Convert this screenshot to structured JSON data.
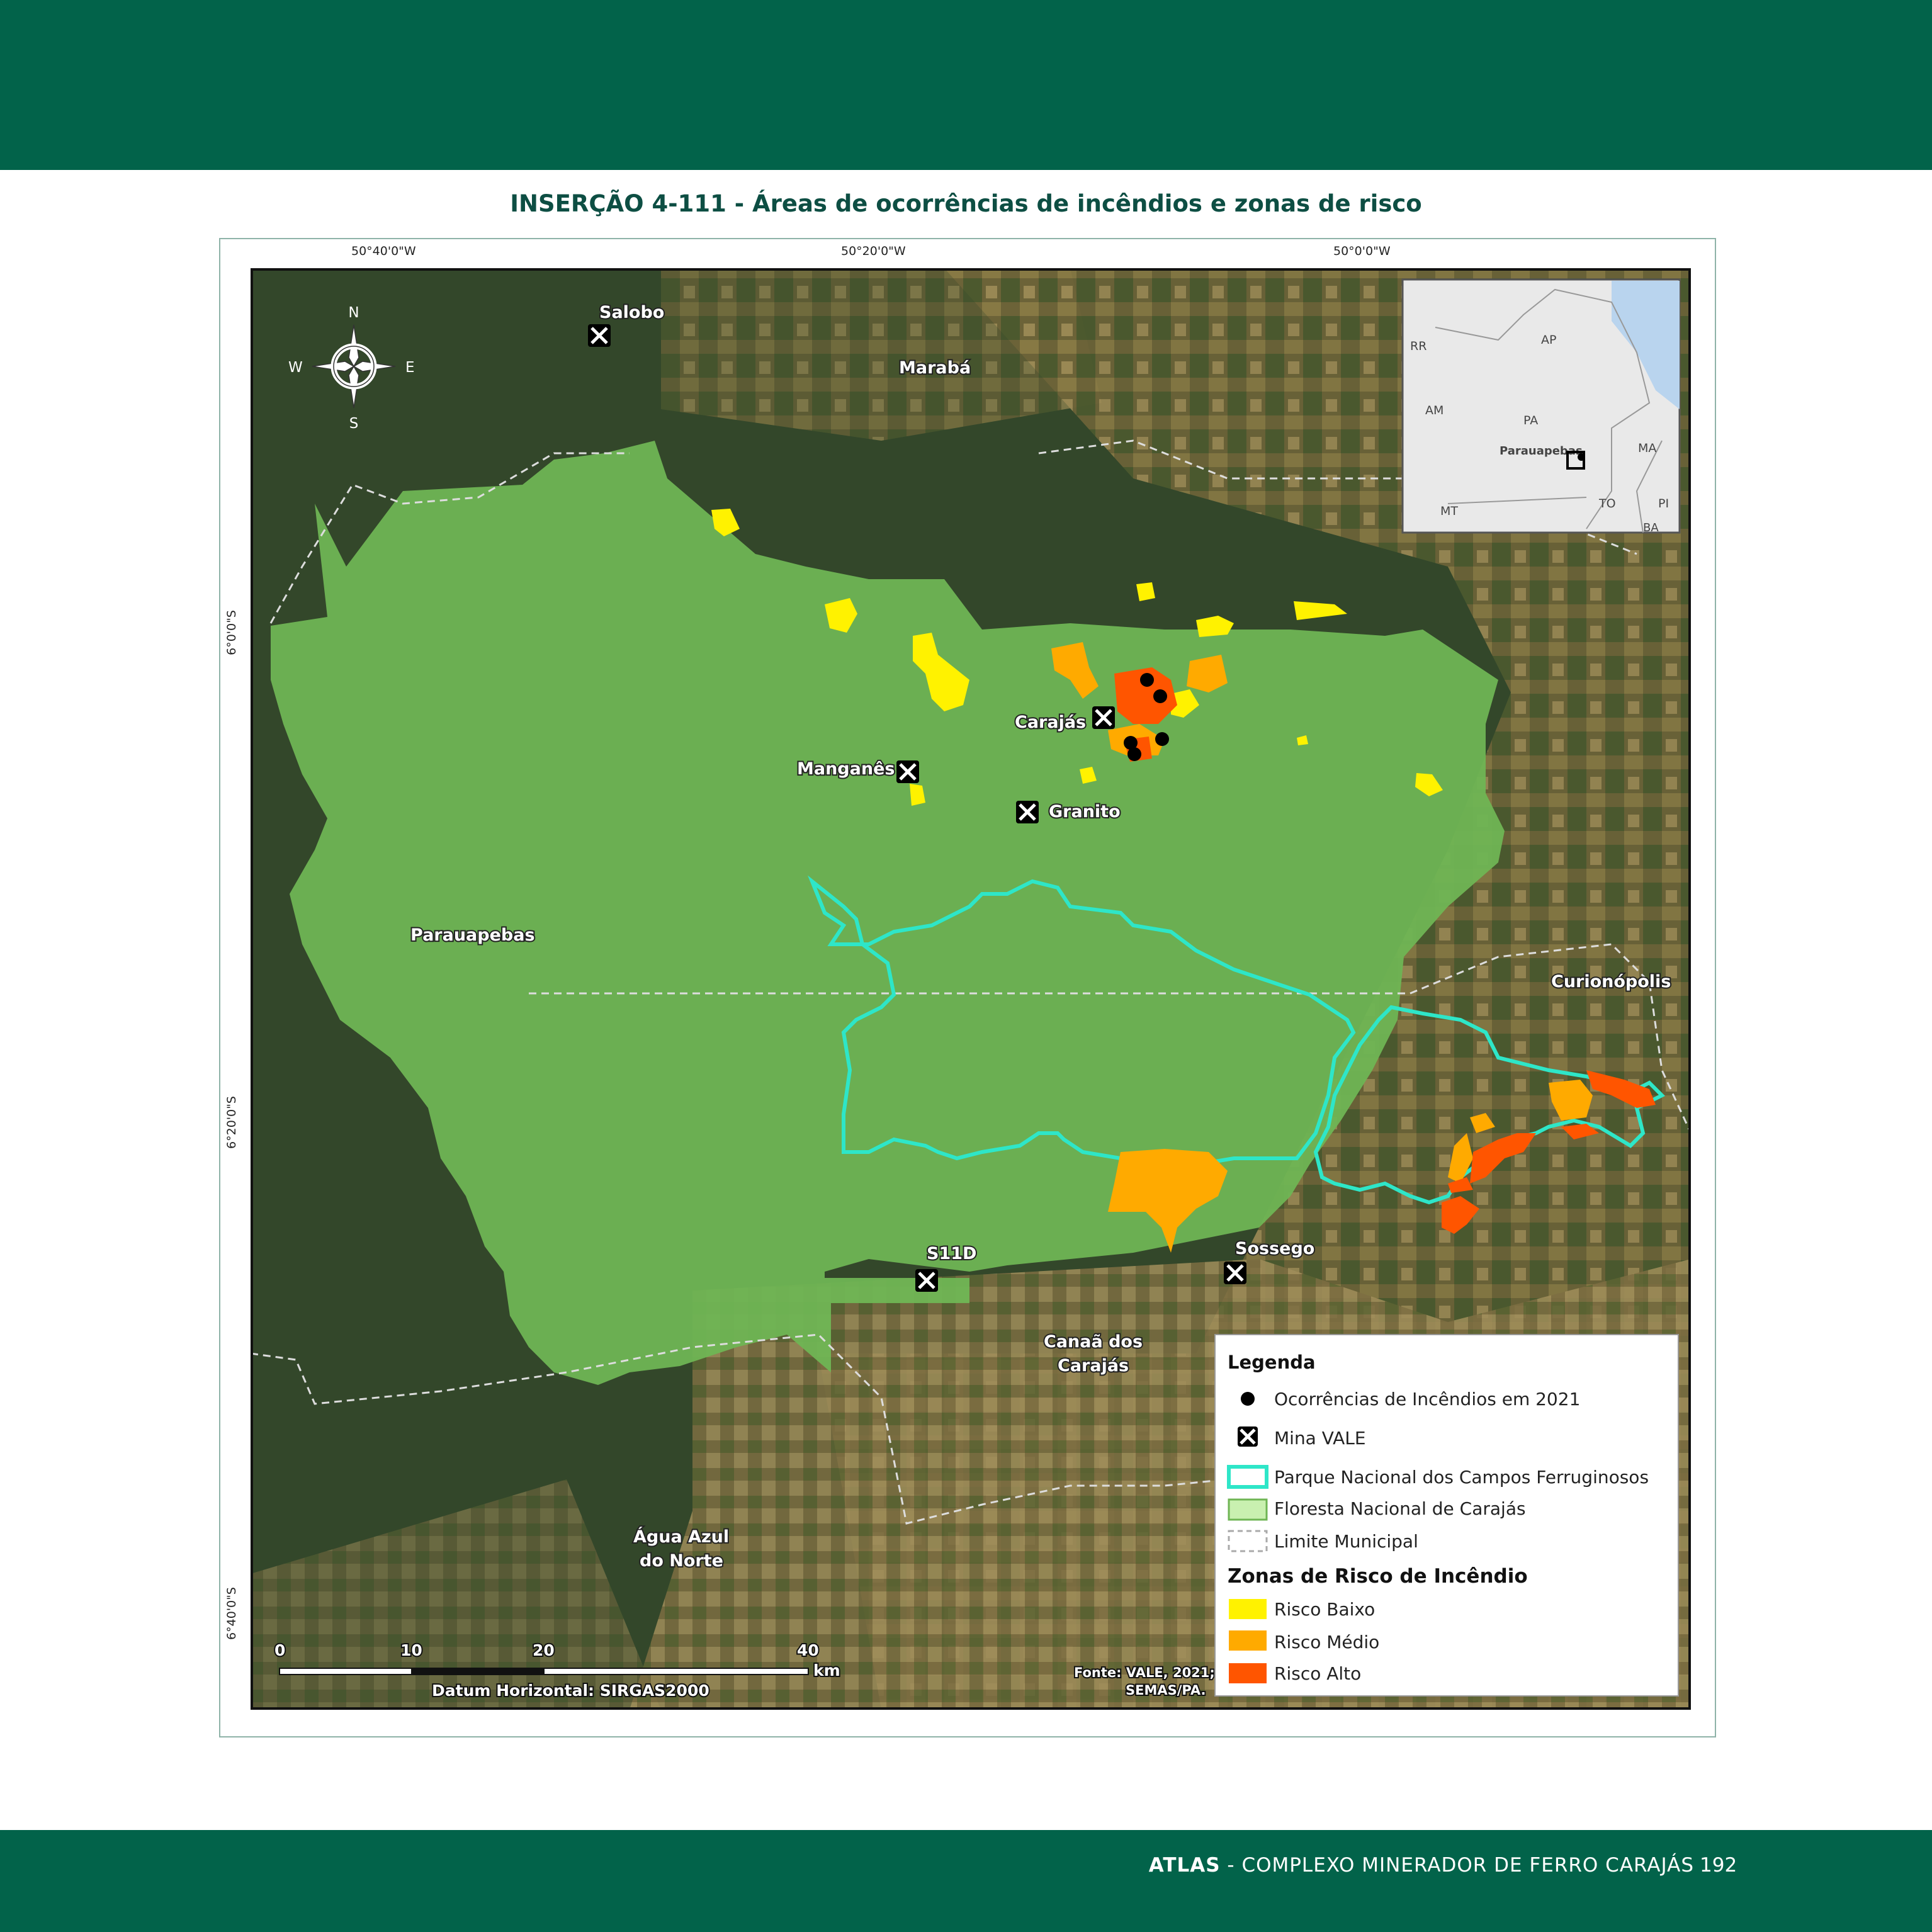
{
  "header": {
    "title": "INSERÇÃO 4-111 - Áreas de ocorrências de incêndios e zonas de risco"
  },
  "footer": {
    "brand": "ATLAS",
    "text": " - COMPLEXO MINERADOR DE FERRO CARAJÁS",
    "page": "192"
  },
  "map": {
    "coords": {
      "top": [
        "50°40'0\"W",
        "50°20'0\"W",
        "50°0'0\"W"
      ],
      "left": [
        "6°0'0\"S",
        "6°20'0\"S",
        "6°40'0\"S"
      ]
    },
    "compass": {
      "n": "N",
      "s": "S",
      "e": "E",
      "w": "W"
    },
    "places": {
      "salobo": "Salobo",
      "maraba": "Marabá",
      "carajas": "Carajás",
      "manganes": "Manganês",
      "granito": "Granito",
      "parauapebas": "Parauapebas",
      "curionopolis": "Curionópolis",
      "s11d": "S11D",
      "sossego": "Sossego",
      "canaa_1": "Canaã dos",
      "canaa_2": "Carajás",
      "agua_1": "Água Azul",
      "agua_2": "do Norte"
    },
    "scale": {
      "t0": "0",
      "t10": "10",
      "t20": "20",
      "t40": "40",
      "unit": "km",
      "datum": "Datum Horizontal: SIRGAS2000"
    },
    "source": {
      "line1": "Fonte: VALE, 2021;",
      "line2": "SEMAS/PA."
    },
    "inset": {
      "labels": {
        "rr": "RR",
        "ap": "AP",
        "am": "AM",
        "pa": "PA",
        "parauapebas": "Parauapebas",
        "ma": "MA",
        "mt": "MT",
        "to": "TO",
        "pi": "PI",
        "ba": "BA"
      }
    },
    "legend": {
      "title": "Legenda",
      "fires": "Ocorrências de Incêndios em 2021",
      "mine": "Mina VALE",
      "park": "Parque Nacional dos Campos Ferruginosos",
      "forest": "Floresta Nacional de Carajás",
      "limit": "Limite Municipal",
      "zones_title": "Zonas de Risco de Incêndio",
      "low": "Risco Baixo",
      "medium": "Risco Médio",
      "high": "Risco Alto"
    },
    "colors": {
      "forest": "#6fb554",
      "park": "#2ee6c8",
      "low": "#fff200",
      "medium": "#ffaa00",
      "high": "#ff5500"
    }
  }
}
